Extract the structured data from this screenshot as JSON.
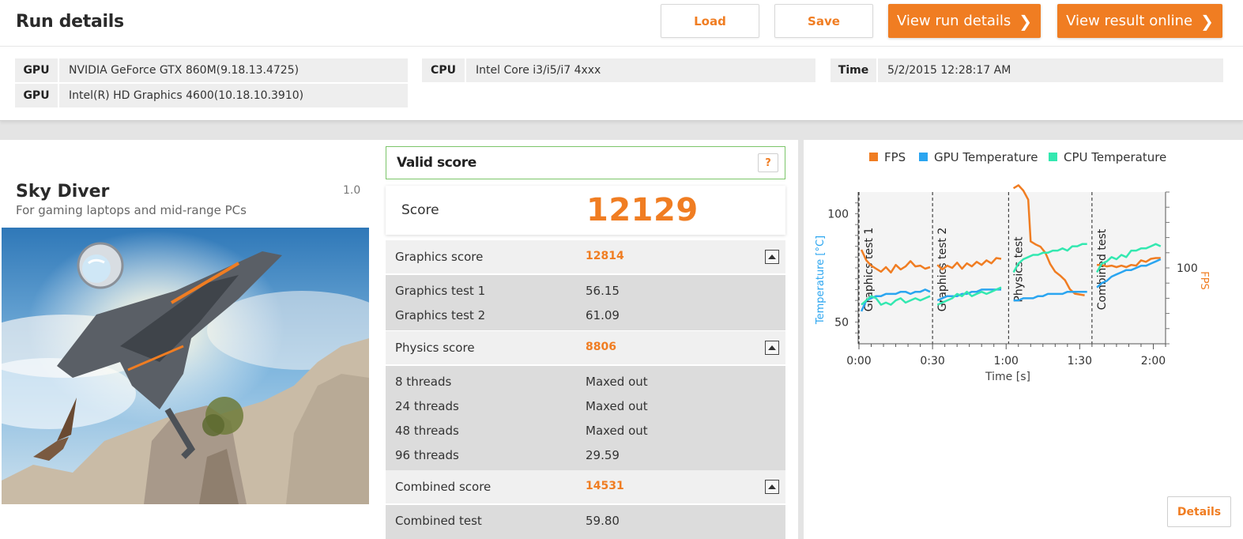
{
  "header": {
    "title": "Run details",
    "buttons": {
      "load": "Load",
      "save": "Save",
      "view_run_details": "View run details",
      "view_result_online": "View result online"
    }
  },
  "system_info": {
    "gpu_label": "GPU",
    "gpu1": "NVIDIA GeForce GTX 860M(9.18.13.4725)",
    "gpu2": "Intel(R) HD Graphics 4600(10.18.10.3910)",
    "cpu_label": "CPU",
    "cpu": "Intel Core i3/i5/i7 4xxx",
    "time_label": "Time",
    "time": "5/2/2015 12:28:17 AM"
  },
  "benchmark": {
    "name": "Sky Diver",
    "version": "1.0",
    "subtitle": "For gaming laptops and mid-range PCs"
  },
  "scores": {
    "valid_label": "Valid score",
    "help": "?",
    "score_label": "Score",
    "score_value": "12129",
    "graphics": {
      "label": "Graphics score",
      "value": "12814",
      "tests": [
        {
          "label": "Graphics test 1",
          "value": "56.15"
        },
        {
          "label": "Graphics test 2",
          "value": "61.09"
        }
      ]
    },
    "physics": {
      "label": "Physics score",
      "value": "8806",
      "tests": [
        {
          "label": "8 threads",
          "value": "Maxed out"
        },
        {
          "label": "24 threads",
          "value": "Maxed out"
        },
        {
          "label": "48 threads",
          "value": "Maxed out"
        },
        {
          "label": "96 threads",
          "value": "29.59"
        }
      ]
    },
    "combined": {
      "label": "Combined score",
      "value": "14531",
      "tests": [
        {
          "label": "Combined test",
          "value": "59.80"
        }
      ]
    }
  },
  "chart_data": {
    "type": "line",
    "legend": [
      "FPS",
      "GPU Temperature",
      "CPU Temperature"
    ],
    "colors": {
      "FPS": "#f07d22",
      "GPU Temperature": "#2aa5f0",
      "CPU Temperature": "#33e8b0"
    },
    "xlabel": "Time [s]",
    "ylabel_left": "Temperature [°C]",
    "ylabel_right": "FPS",
    "x_ticks": [
      "0:00",
      "0:30",
      "1:00",
      "1:30",
      "2:00"
    ],
    "y_left_ticks": [
      "50",
      "100"
    ],
    "y_right_ticks": [
      "100"
    ],
    "xlim": [
      0,
      125
    ],
    "ylim_left": [
      40,
      110
    ],
    "ylim_right": [
      0,
      200
    ],
    "sections": [
      {
        "label": "Graphics test 1",
        "x": 0
      },
      {
        "label": "Graphics test 2",
        "x": 30
      },
      {
        "label": "Physics test",
        "x": 61
      },
      {
        "label": "Combined test",
        "x": 95
      }
    ],
    "series": [
      {
        "name": "FPS",
        "axis": "right",
        "segments": [
          [
            [
              1,
              124
            ],
            [
              3,
              110
            ],
            [
              5,
              103
            ],
            [
              7,
              99
            ],
            [
              9,
              95
            ],
            [
              11,
              101
            ],
            [
              13,
              94
            ],
            [
              15,
              104
            ],
            [
              17,
              98
            ],
            [
              19,
              102
            ],
            [
              21,
              109
            ],
            [
              23,
              102
            ],
            [
              25,
              103
            ],
            [
              27,
              99
            ],
            [
              29,
              101
            ]
          ],
          [
            [
              32,
              104
            ],
            [
              34,
              98
            ],
            [
              36,
              103
            ],
            [
              38,
              100
            ],
            [
              40,
              107
            ],
            [
              42,
              99
            ],
            [
              44,
              106
            ],
            [
              46,
              102
            ],
            [
              48,
              108
            ],
            [
              50,
              104
            ],
            [
              52,
              110
            ],
            [
              54,
              106
            ],
            [
              56,
              113
            ],
            [
              58,
              112
            ]
          ],
          [
            [
              63,
              205
            ],
            [
              65,
              209
            ],
            [
              67,
              202
            ],
            [
              69,
              190
            ],
            [
              70,
              135
            ],
            [
              72,
              131
            ],
            [
              74,
              128
            ],
            [
              76,
              120
            ],
            [
              78,
              105
            ],
            [
              80,
              95
            ],
            [
              82,
              90
            ],
            [
              84,
              84
            ],
            [
              86,
              72
            ],
            [
              88,
              66
            ],
            [
              90,
              65
            ],
            [
              92,
              64
            ]
          ],
          [
            [
              97,
              104
            ],
            [
              99,
              104
            ],
            [
              101,
              102
            ],
            [
              103,
              103
            ],
            [
              105,
              101
            ],
            [
              107,
              103
            ],
            [
              109,
              101
            ],
            [
              111,
              104
            ],
            [
              113,
              103
            ],
            [
              115,
              110
            ],
            [
              117,
              108
            ],
            [
              119,
              112
            ],
            [
              121,
              113
            ],
            [
              123,
              113
            ]
          ]
        ]
      },
      {
        "name": "GPU Temperature",
        "axis": "left",
        "segments": [
          [
            [
              1,
              55
            ],
            [
              3,
              60
            ],
            [
              5,
              61
            ],
            [
              7,
              62
            ],
            [
              9,
              62
            ],
            [
              11,
              63
            ],
            [
              13,
              63
            ],
            [
              15,
              63
            ],
            [
              17,
              64
            ],
            [
              19,
              64
            ],
            [
              21,
              63
            ],
            [
              23,
              64
            ],
            [
              25,
              64
            ],
            [
              27,
              65
            ],
            [
              29,
              64
            ]
          ],
          [
            [
              32,
              60
            ],
            [
              34,
              61
            ],
            [
              36,
              62
            ],
            [
              38,
              62
            ],
            [
              40,
              62
            ],
            [
              42,
              63
            ],
            [
              44,
              63
            ],
            [
              46,
              64
            ],
            [
              48,
              64
            ],
            [
              50,
              65
            ],
            [
              52,
              65
            ],
            [
              54,
              65
            ],
            [
              56,
              65
            ],
            [
              58,
              65
            ]
          ],
          [
            [
              63,
              60
            ],
            [
              65,
              60
            ],
            [
              67,
              61
            ],
            [
              69,
              61
            ],
            [
              71,
              61
            ],
            [
              73,
              62
            ],
            [
              75,
              62
            ],
            [
              77,
              63
            ],
            [
              79,
              63
            ],
            [
              81,
              63
            ],
            [
              83,
              63
            ],
            [
              85,
              64
            ],
            [
              87,
              64
            ],
            [
              89,
              64
            ],
            [
              91,
              64
            ],
            [
              93,
              64
            ]
          ],
          [
            [
              97,
              66
            ],
            [
              99,
              68
            ],
            [
              101,
              69
            ],
            [
              103,
              71
            ],
            [
              105,
              72
            ],
            [
              107,
              73
            ],
            [
              109,
              74
            ],
            [
              111,
              74
            ],
            [
              113,
              75
            ],
            [
              115,
              76
            ],
            [
              117,
              76
            ],
            [
              119,
              77
            ],
            [
              121,
              78
            ],
            [
              123,
              79
            ]
          ]
        ]
      },
      {
        "name": "CPU Temperature",
        "axis": "left",
        "segments": [
          [
            [
              1,
              58
            ],
            [
              3,
              60
            ],
            [
              5,
              62
            ],
            [
              7,
              61
            ],
            [
              9,
              58
            ],
            [
              11,
              59
            ],
            [
              13,
              58
            ],
            [
              15,
              60
            ],
            [
              17,
              61
            ],
            [
              19,
              59
            ],
            [
              21,
              60
            ],
            [
              23,
              61
            ],
            [
              25,
              60
            ],
            [
              27,
              61
            ],
            [
              29,
              62
            ]
          ],
          [
            [
              32,
              58
            ],
            [
              34,
              59
            ],
            [
              36,
              60
            ],
            [
              38,
              61
            ],
            [
              40,
              63
            ],
            [
              42,
              62
            ],
            [
              44,
              64
            ],
            [
              46,
              62
            ],
            [
              48,
              63
            ],
            [
              50,
              64
            ],
            [
              52,
              63
            ],
            [
              54,
              64
            ],
            [
              56,
              65
            ],
            [
              58,
              66
            ]
          ],
          [
            [
              63,
              73
            ],
            [
              65,
              77
            ],
            [
              67,
              79
            ],
            [
              69,
              80
            ],
            [
              71,
              81
            ],
            [
              73,
              81
            ],
            [
              75,
              82
            ],
            [
              77,
              82
            ],
            [
              79,
              83
            ],
            [
              81,
              83
            ],
            [
              83,
              84
            ],
            [
              85,
              83
            ],
            [
              87,
              85
            ],
            [
              89,
              85
            ],
            [
              91,
              86
            ],
            [
              93,
              86
            ]
          ],
          [
            [
              97,
              73
            ],
            [
              99,
              77
            ],
            [
              101,
              78
            ],
            [
              103,
              80
            ],
            [
              105,
              79
            ],
            [
              107,
              81
            ],
            [
              109,
              80
            ],
            [
              111,
              83
            ],
            [
              113,
              83
            ],
            [
              115,
              84
            ],
            [
              117,
              84
            ],
            [
              119,
              85
            ],
            [
              121,
              86
            ],
            [
              123,
              85
            ]
          ]
        ]
      }
    ]
  }
}
